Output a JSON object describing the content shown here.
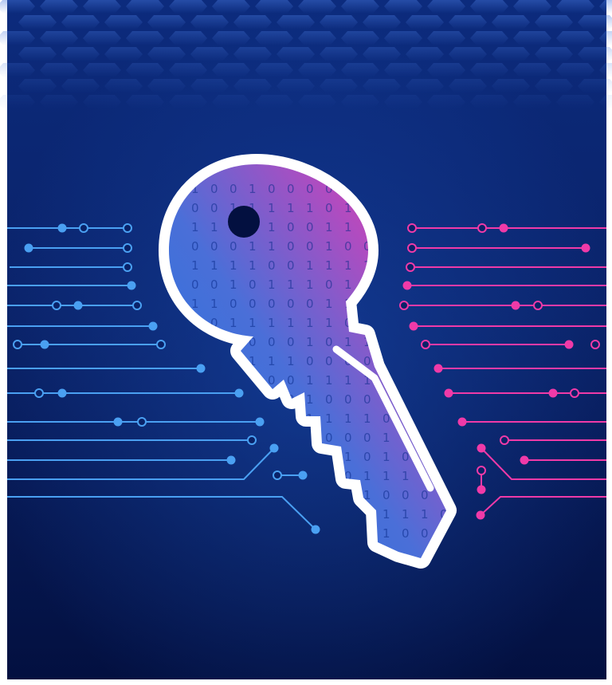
{
  "illustration": {
    "subject": "key-icon",
    "background_top": "#0b2a78",
    "background_bottom": "#031040",
    "accent_blue": "#4aa0f2",
    "accent_pink": "#f03aa8"
  }
}
